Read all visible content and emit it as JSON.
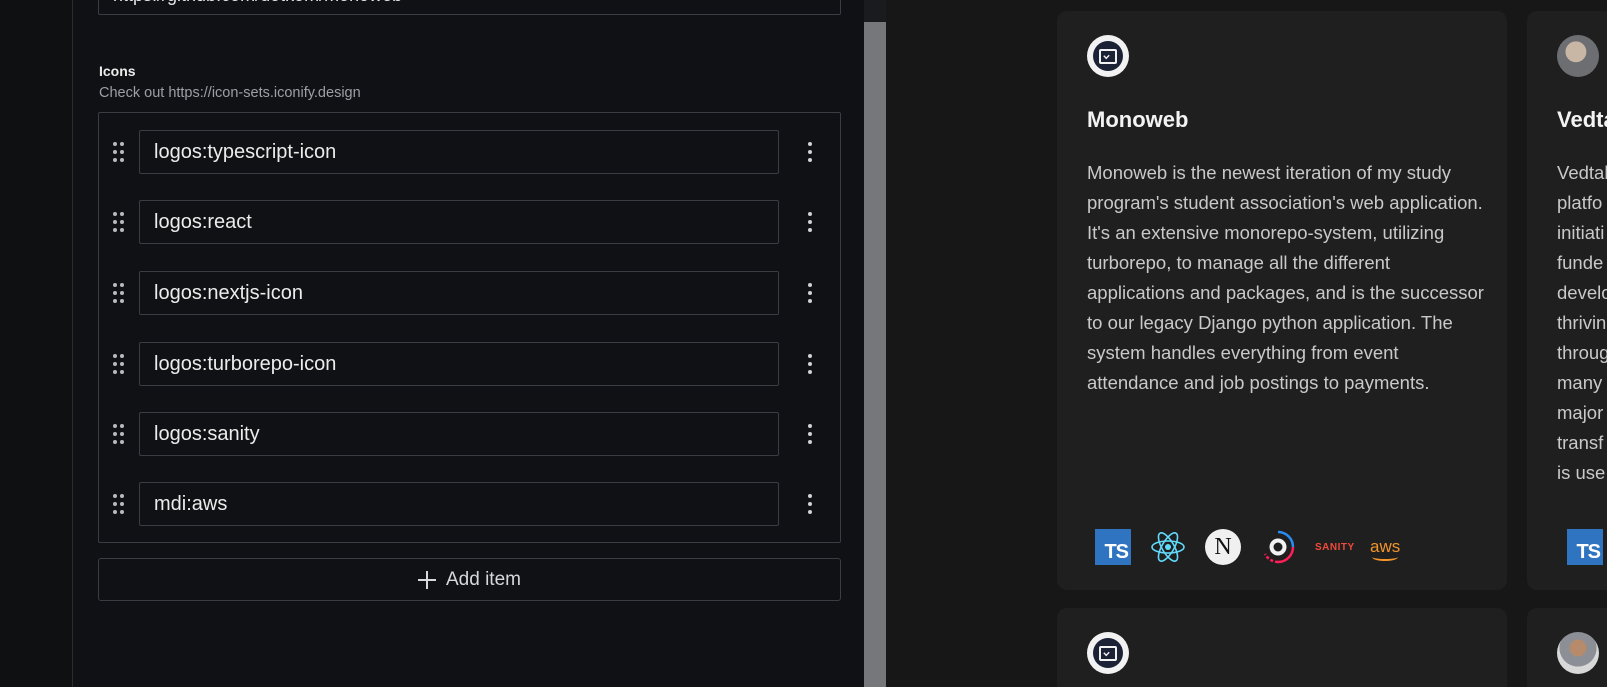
{
  "studio": {
    "url_field": {
      "value": "https://github.com/dotkom/monoweb"
    },
    "icons_field": {
      "title": "Icons",
      "description": "Check out https://icon-sets.iconify.design",
      "items": [
        {
          "value": "logos:typescript-icon"
        },
        {
          "value": "logos:react"
        },
        {
          "value": "logos:nextjs-icon"
        },
        {
          "value": "logos:turborepo-icon"
        },
        {
          "value": "logos:sanity"
        },
        {
          "value": "mdi:aws"
        }
      ],
      "add_item_label": "Add item"
    }
  },
  "preview": {
    "card_main": {
      "title": "Monoweb",
      "description": "Monoweb is the newest iteration of my study program's student association's web application. It's an extensive monorepo-system, utilizing turborepo, to manage all the different applications and packages, and is the successor to our legacy Django python application. The system handles everything from event attendance and job postings to payments.",
      "tech_icons": [
        {
          "icon": "typescript-icon",
          "label": "TS"
        },
        {
          "icon": "react-icon"
        },
        {
          "icon": "nextjs-icon",
          "label": "N"
        },
        {
          "icon": "turborepo-icon"
        },
        {
          "icon": "sanity-icon",
          "label": "SANITY"
        },
        {
          "icon": "aws-icon",
          "label": "aws"
        }
      ]
    },
    "card_side": {
      "title": "Vedtak",
      "description_lines": [
        "Vedtak",
        "platfo",
        "initiati",
        "funde",
        "develo",
        "thrivin",
        "throug",
        "many",
        "major",
        "transf",
        "is use"
      ],
      "tech_label": "TS"
    }
  },
  "colors": {
    "studio_bg": "#101114",
    "preview_bg": "#171717",
    "card_bg": "#1f1f1f",
    "typescript": "#2f74c0",
    "react": "#61dafb",
    "sanity": "#f04a3b",
    "aws": "#f2942a"
  }
}
